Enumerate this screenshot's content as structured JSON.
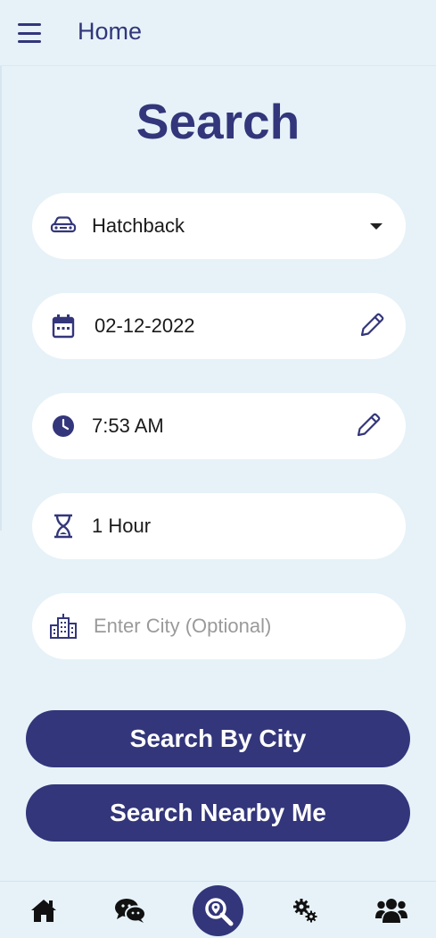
{
  "appbar": {
    "title": "Home",
    "menu_icon": "hamburger-menu-icon"
  },
  "page": {
    "title": "Search"
  },
  "form": {
    "vehicle_type": {
      "value": "Hatchback",
      "icon": "car-icon"
    },
    "date": {
      "value": "02-12-2022",
      "icon": "calendar-icon",
      "edit_icon": "pencil-icon"
    },
    "time": {
      "value": "7:53 AM",
      "icon": "clock-icon",
      "edit_icon": "pencil-icon"
    },
    "duration": {
      "value": "1 Hour",
      "icon": "hourglass-icon"
    },
    "city": {
      "placeholder": "Enter City (Optional)",
      "value": "",
      "icon": "city-building-icon"
    }
  },
  "actions": {
    "search_by_city": "Search By City",
    "search_nearby": "Search Nearby Me"
  },
  "bottom_nav": {
    "items": [
      {
        "name": "home",
        "icon": "home-icon"
      },
      {
        "name": "chat",
        "icon": "chat-icon"
      },
      {
        "name": "search",
        "icon": "search-location-icon",
        "active": true
      },
      {
        "name": "settings",
        "icon": "gears-icon"
      },
      {
        "name": "users",
        "icon": "users-icon"
      }
    ]
  },
  "colors": {
    "primary": "#33367a",
    "background": "#e6f2f8",
    "field": "#ffffff"
  }
}
